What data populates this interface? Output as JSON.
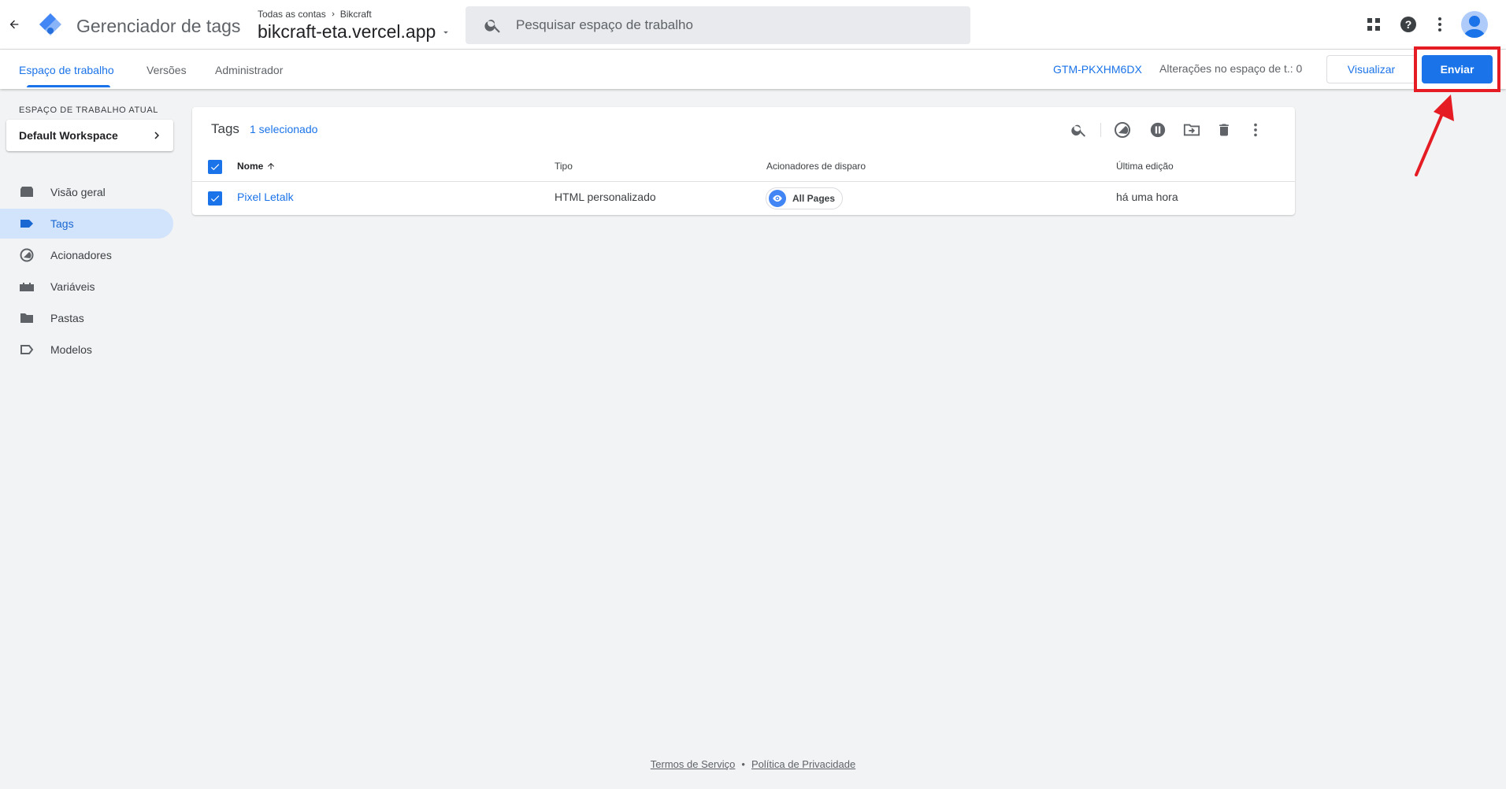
{
  "header": {
    "product_name": "Gerenciador de tags",
    "breadcrumb_accounts": "Todas as contas",
    "breadcrumb_account": "Bikcraft",
    "container_name": "bikcraft-eta.vercel.app",
    "search_placeholder": "Pesquisar espaço de trabalho"
  },
  "subnav": {
    "tabs": [
      {
        "label": "Espaço de trabalho",
        "active": true
      },
      {
        "label": "Versões",
        "active": false
      },
      {
        "label": "Administrador",
        "active": false
      }
    ],
    "container_id": "GTM-PKXHM6DX",
    "changes_text": "Alterações no espaço de t.: 0",
    "preview_label": "Visualizar",
    "submit_label": "Enviar"
  },
  "sidebar": {
    "workspace_heading": "ESPAÇO DE TRABALHO ATUAL",
    "workspace_name": "Default Workspace",
    "items": [
      {
        "label": "Visão geral",
        "icon": "overview-icon",
        "active": false
      },
      {
        "label": "Tags",
        "icon": "tag-icon",
        "active": true
      },
      {
        "label": "Acionadores",
        "icon": "trigger-icon",
        "active": false
      },
      {
        "label": "Variáveis",
        "icon": "variable-icon",
        "active": false
      },
      {
        "label": "Pastas",
        "icon": "folder-icon",
        "active": false
      },
      {
        "label": "Modelos",
        "icon": "template-icon",
        "active": false
      }
    ]
  },
  "tags_table": {
    "title": "Tags",
    "selected_text": "1 selecionado",
    "columns": {
      "name": "Nome",
      "type": "Tipo",
      "triggers": "Acionadores de disparo",
      "last_edited": "Última edição"
    },
    "rows": [
      {
        "name": "Pixel Letalk",
        "type": "HTML personalizado",
        "trigger": "All Pages",
        "last_edited": "há uma hora",
        "checked": true
      }
    ]
  },
  "footer": {
    "terms": "Termos de Serviço",
    "separator": "•",
    "privacy": "Política de Privacidade"
  },
  "colors": {
    "accent": "#1a73e8",
    "highlight": "#e51c23"
  }
}
